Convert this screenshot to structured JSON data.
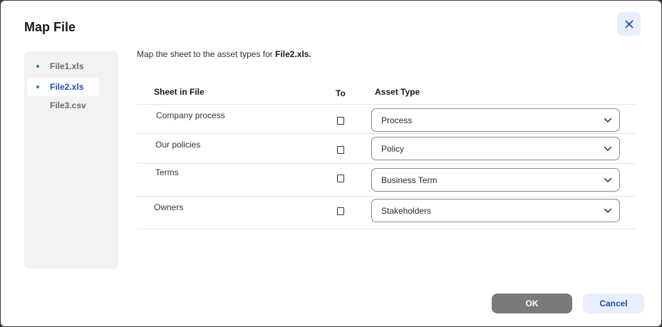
{
  "dialog": {
    "title": "Map File",
    "close_icon": "close-icon"
  },
  "files": [
    {
      "name": "File1.xls",
      "has_dot": true,
      "selected": false
    },
    {
      "name": "File2.xls",
      "has_dot": true,
      "selected": true
    },
    {
      "name": "File3.csv",
      "has_dot": false,
      "selected": false
    }
  ],
  "instruction": {
    "prefix": "Map the sheet to the asset types for ",
    "file": "File2.xls."
  },
  "table": {
    "headers": {
      "sheet": "Sheet in File",
      "to": "To",
      "asset_type": "Asset Type"
    },
    "rows": [
      {
        "sheet": "Company process",
        "checked": false,
        "asset_type": "Process"
      },
      {
        "sheet": "Our policies",
        "checked": false,
        "asset_type": "Policy"
      },
      {
        "sheet": "Terms",
        "checked": false,
        "asset_type": "Business Term"
      },
      {
        "sheet": "Owners",
        "checked": false,
        "asset_type": "Stakeholders"
      }
    ]
  },
  "footer": {
    "ok_label": "OK",
    "cancel_label": "Cancel"
  },
  "colors": {
    "accent": "#1f4fb8",
    "dot": "#2e8b4a",
    "ok_bg": "#7a7a7a",
    "cancel_bg": "#e8eefc"
  }
}
